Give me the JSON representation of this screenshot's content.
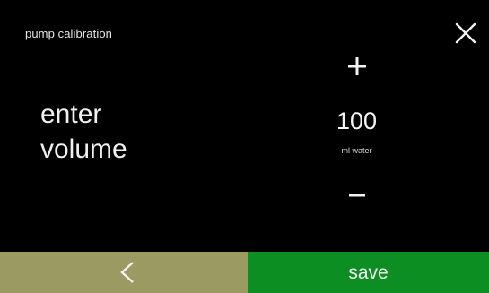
{
  "header": {
    "title": "pump calibration",
    "close_icon": "close-icon"
  },
  "prompt": {
    "line1": "enter",
    "line2": "volume"
  },
  "stepper": {
    "increment_icon": "plus-icon",
    "value": "100",
    "unit": "ml water",
    "decrement_icon": "minus-icon"
  },
  "footer": {
    "back_icon": "chevron-left-icon",
    "save_label": "save",
    "colors": {
      "back_bg": "#9c9a63",
      "save_bg": "#0c8e23"
    }
  }
}
